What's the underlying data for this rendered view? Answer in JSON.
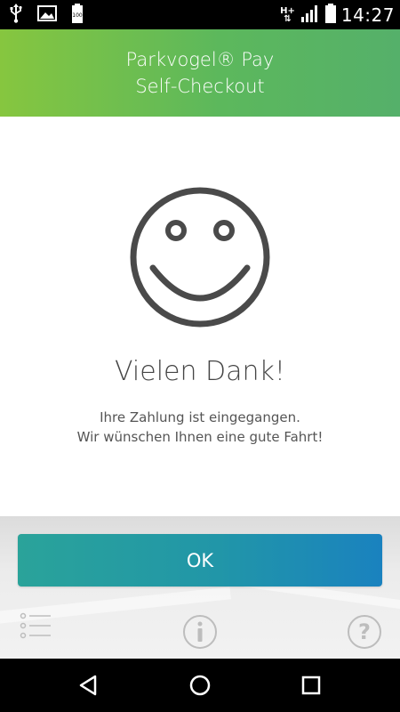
{
  "status_bar": {
    "time": "14:27",
    "network_label": "H+",
    "battery_label": "100",
    "icons": [
      "usb-icon",
      "image-icon",
      "battery-small-icon",
      "hplus-data-icon",
      "signal-icon",
      "battery-icon"
    ]
  },
  "header": {
    "title_line1": "Parkvogel® Pay",
    "title_line2": "Self-Checkout"
  },
  "content": {
    "icon": "smiley-icon",
    "heading": "Vielen Dank!",
    "message_line1": "Ihre Zahlung ist eingegangen.",
    "message_line2": "Wir wünschen Ihnen eine gute Fahrt!"
  },
  "actions": {
    "ok_label": "OK"
  },
  "bottom_bar": {
    "icons": [
      "menu-list-icon",
      "info-icon",
      "help-icon"
    ]
  },
  "nav_bar": {
    "icons": [
      "back-icon",
      "home-icon",
      "recents-icon"
    ]
  },
  "colors": {
    "header_start": "#86c63f",
    "header_end": "#55b06a",
    "button_start": "#2aa39a",
    "button_end": "#1a82bf",
    "text_dark": "#454545"
  }
}
